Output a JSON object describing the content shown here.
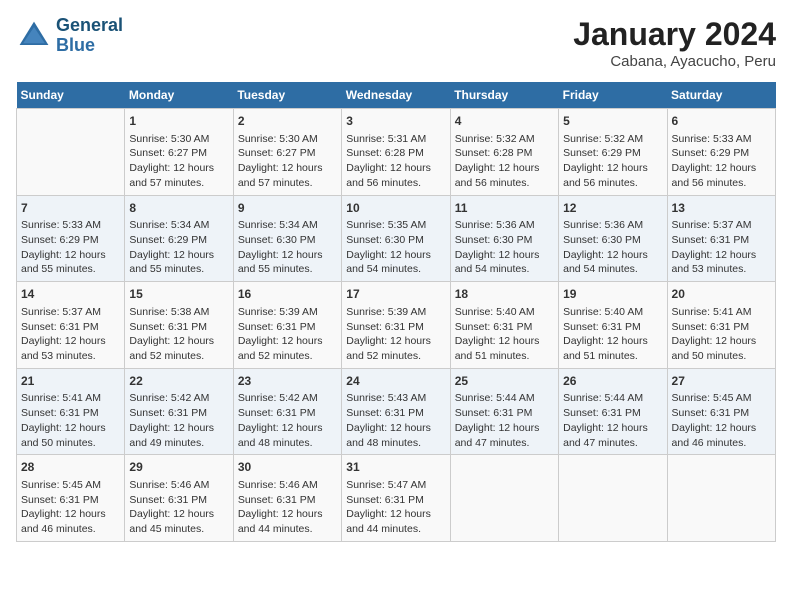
{
  "header": {
    "logo_line1": "General",
    "logo_line2": "Blue",
    "title": "January 2024",
    "subtitle": "Cabana, Ayacucho, Peru"
  },
  "weekdays": [
    "Sunday",
    "Monday",
    "Tuesday",
    "Wednesday",
    "Thursday",
    "Friday",
    "Saturday"
  ],
  "weeks": [
    [
      {
        "day": "",
        "content": ""
      },
      {
        "day": "1",
        "content": "Sunrise: 5:30 AM\nSunset: 6:27 PM\nDaylight: 12 hours\nand 57 minutes."
      },
      {
        "day": "2",
        "content": "Sunrise: 5:30 AM\nSunset: 6:27 PM\nDaylight: 12 hours\nand 57 minutes."
      },
      {
        "day": "3",
        "content": "Sunrise: 5:31 AM\nSunset: 6:28 PM\nDaylight: 12 hours\nand 56 minutes."
      },
      {
        "day": "4",
        "content": "Sunrise: 5:32 AM\nSunset: 6:28 PM\nDaylight: 12 hours\nand 56 minutes."
      },
      {
        "day": "5",
        "content": "Sunrise: 5:32 AM\nSunset: 6:29 PM\nDaylight: 12 hours\nand 56 minutes."
      },
      {
        "day": "6",
        "content": "Sunrise: 5:33 AM\nSunset: 6:29 PM\nDaylight: 12 hours\nand 56 minutes."
      }
    ],
    [
      {
        "day": "7",
        "content": "Sunrise: 5:33 AM\nSunset: 6:29 PM\nDaylight: 12 hours\nand 55 minutes."
      },
      {
        "day": "8",
        "content": "Sunrise: 5:34 AM\nSunset: 6:29 PM\nDaylight: 12 hours\nand 55 minutes."
      },
      {
        "day": "9",
        "content": "Sunrise: 5:34 AM\nSunset: 6:30 PM\nDaylight: 12 hours\nand 55 minutes."
      },
      {
        "day": "10",
        "content": "Sunrise: 5:35 AM\nSunset: 6:30 PM\nDaylight: 12 hours\nand 54 minutes."
      },
      {
        "day": "11",
        "content": "Sunrise: 5:36 AM\nSunset: 6:30 PM\nDaylight: 12 hours\nand 54 minutes."
      },
      {
        "day": "12",
        "content": "Sunrise: 5:36 AM\nSunset: 6:30 PM\nDaylight: 12 hours\nand 54 minutes."
      },
      {
        "day": "13",
        "content": "Sunrise: 5:37 AM\nSunset: 6:31 PM\nDaylight: 12 hours\nand 53 minutes."
      }
    ],
    [
      {
        "day": "14",
        "content": "Sunrise: 5:37 AM\nSunset: 6:31 PM\nDaylight: 12 hours\nand 53 minutes."
      },
      {
        "day": "15",
        "content": "Sunrise: 5:38 AM\nSunset: 6:31 PM\nDaylight: 12 hours\nand 52 minutes."
      },
      {
        "day": "16",
        "content": "Sunrise: 5:39 AM\nSunset: 6:31 PM\nDaylight: 12 hours\nand 52 minutes."
      },
      {
        "day": "17",
        "content": "Sunrise: 5:39 AM\nSunset: 6:31 PM\nDaylight: 12 hours\nand 52 minutes."
      },
      {
        "day": "18",
        "content": "Sunrise: 5:40 AM\nSunset: 6:31 PM\nDaylight: 12 hours\nand 51 minutes."
      },
      {
        "day": "19",
        "content": "Sunrise: 5:40 AM\nSunset: 6:31 PM\nDaylight: 12 hours\nand 51 minutes."
      },
      {
        "day": "20",
        "content": "Sunrise: 5:41 AM\nSunset: 6:31 PM\nDaylight: 12 hours\nand 50 minutes."
      }
    ],
    [
      {
        "day": "21",
        "content": "Sunrise: 5:41 AM\nSunset: 6:31 PM\nDaylight: 12 hours\nand 50 minutes."
      },
      {
        "day": "22",
        "content": "Sunrise: 5:42 AM\nSunset: 6:31 PM\nDaylight: 12 hours\nand 49 minutes."
      },
      {
        "day": "23",
        "content": "Sunrise: 5:42 AM\nSunset: 6:31 PM\nDaylight: 12 hours\nand 48 minutes."
      },
      {
        "day": "24",
        "content": "Sunrise: 5:43 AM\nSunset: 6:31 PM\nDaylight: 12 hours\nand 48 minutes."
      },
      {
        "day": "25",
        "content": "Sunrise: 5:44 AM\nSunset: 6:31 PM\nDaylight: 12 hours\nand 47 minutes."
      },
      {
        "day": "26",
        "content": "Sunrise: 5:44 AM\nSunset: 6:31 PM\nDaylight: 12 hours\nand 47 minutes."
      },
      {
        "day": "27",
        "content": "Sunrise: 5:45 AM\nSunset: 6:31 PM\nDaylight: 12 hours\nand 46 minutes."
      }
    ],
    [
      {
        "day": "28",
        "content": "Sunrise: 5:45 AM\nSunset: 6:31 PM\nDaylight: 12 hours\nand 46 minutes."
      },
      {
        "day": "29",
        "content": "Sunrise: 5:46 AM\nSunset: 6:31 PM\nDaylight: 12 hours\nand 45 minutes."
      },
      {
        "day": "30",
        "content": "Sunrise: 5:46 AM\nSunset: 6:31 PM\nDaylight: 12 hours\nand 44 minutes."
      },
      {
        "day": "31",
        "content": "Sunrise: 5:47 AM\nSunset: 6:31 PM\nDaylight: 12 hours\nand 44 minutes."
      },
      {
        "day": "",
        "content": ""
      },
      {
        "day": "",
        "content": ""
      },
      {
        "day": "",
        "content": ""
      }
    ]
  ]
}
